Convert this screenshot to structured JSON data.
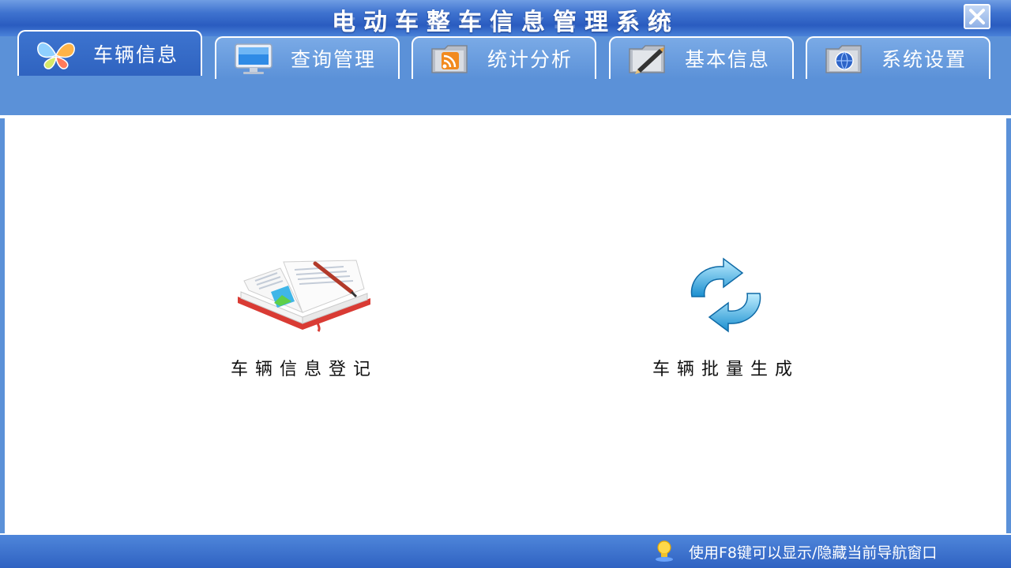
{
  "window": {
    "title": "电动车整车信息管理系统"
  },
  "tabs": [
    {
      "label": "车辆信息",
      "icon": "butterfly-icon",
      "active": true
    },
    {
      "label": "查询管理",
      "icon": "monitor-icon",
      "active": false
    },
    {
      "label": "统计分析",
      "icon": "rss-folder-icon",
      "active": false
    },
    {
      "label": "基本信息",
      "icon": "pencil-folder-icon",
      "active": false
    },
    {
      "label": "系统设置",
      "icon": "globe-folder-icon",
      "active": false
    }
  ],
  "actions": [
    {
      "label": "车辆信息登记",
      "icon": "open-book-icon"
    },
    {
      "label": "车辆批量生成",
      "icon": "refresh-arrows-icon"
    }
  ],
  "status": {
    "hint": "使用F8键可以显示/隐藏当前导航窗口",
    "icon": "lightbulb-icon"
  },
  "colors": {
    "titlebar": "#3f73cf",
    "tabstrip": "#5b91d8",
    "active_tab": "#2f63c0",
    "statusbar": "#2f62c2"
  }
}
